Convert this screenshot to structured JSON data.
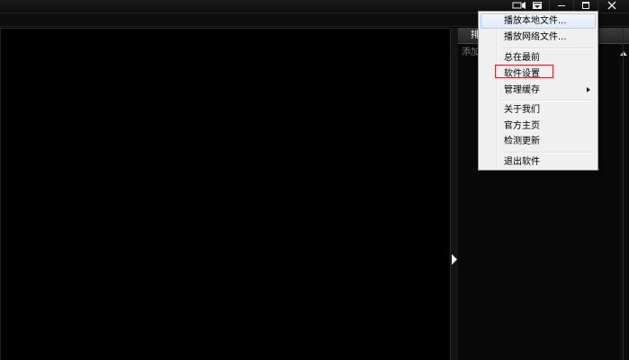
{
  "playlist": {
    "tab_label": "排",
    "add_hint": "添加"
  },
  "titlebar": {
    "icons": {
      "mini_mode": "mini-mode-icon",
      "main_menu": "main-menu-icon",
      "minimize": "minimize-icon",
      "maximize": "maximize-icon",
      "close": "close-icon"
    }
  },
  "menu": {
    "items": [
      {
        "label": "播放本地文件..."
      },
      {
        "label": "播放网络文件..."
      },
      {
        "label": "总在最前"
      },
      {
        "label": "软件设置"
      },
      {
        "label": "管理缓存"
      },
      {
        "label": "关于我们"
      },
      {
        "label": "官方主页"
      },
      {
        "label": "检测更新"
      },
      {
        "label": "退出软件"
      }
    ]
  },
  "colors": {
    "background": "#000000",
    "menu_background": "#f0f0f0",
    "highlight_border": "#e02020",
    "hover_border": "#aecff7"
  }
}
